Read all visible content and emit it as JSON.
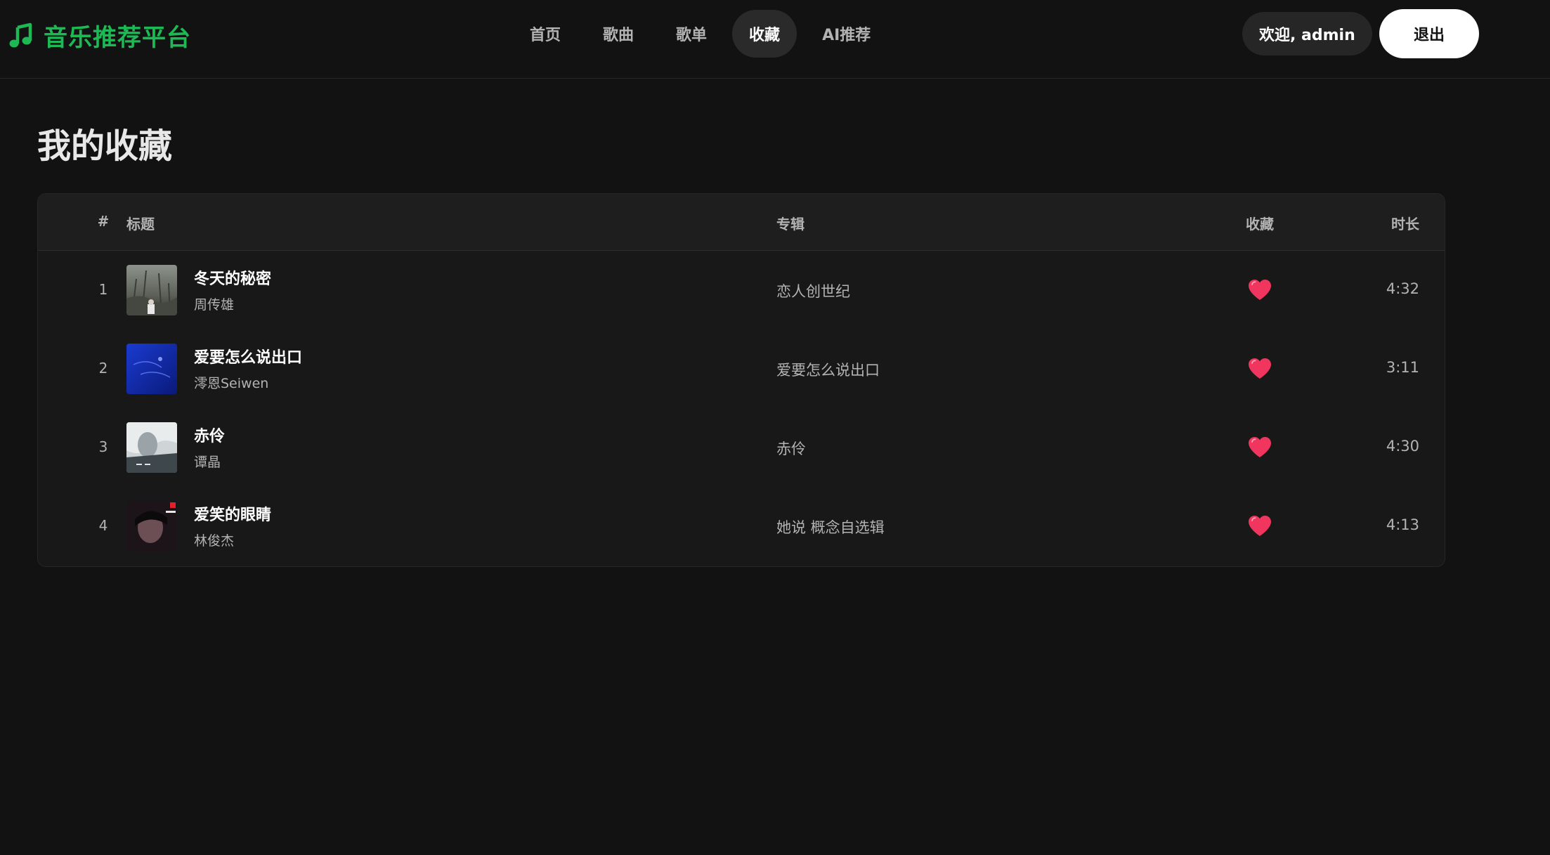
{
  "header": {
    "brand": "音乐推荐平台",
    "nav": [
      {
        "label": "首页"
      },
      {
        "label": "歌曲"
      },
      {
        "label": "歌单"
      },
      {
        "label": "收藏"
      },
      {
        "label": "AI推荐"
      }
    ],
    "active_nav": "收藏",
    "welcome": "欢迎, admin",
    "logout": "退出"
  },
  "main": {
    "title": "我的收藏",
    "table": {
      "columns": {
        "num": "#",
        "title": "标题",
        "album": "专辑",
        "favorite": "收藏",
        "duration": "时长"
      },
      "rows": [
        {
          "num": "1",
          "title": "冬天的秘密",
          "artist": "周传雄",
          "album": "恋人创世纪",
          "duration": "4:32",
          "favorited": true
        },
        {
          "num": "2",
          "title": "爱要怎么说出口",
          "artist": "澪恩Seiwen",
          "album": "爱要怎么说出口",
          "duration": "3:11",
          "favorited": true
        },
        {
          "num": "3",
          "title": "赤伶",
          "artist": "谭晶",
          "album": "赤伶",
          "duration": "4:30",
          "favorited": true
        },
        {
          "num": "4",
          "title": "爱笑的眼睛",
          "artist": "林俊杰",
          "album": "她说 概念自选辑",
          "duration": "4:13",
          "favorited": true
        }
      ]
    }
  },
  "colors": {
    "brand": "#1db954",
    "background": "#121212",
    "heart": "#f0355f"
  },
  "icons": {
    "brand": "music-note-icon",
    "favorite": "heart-icon"
  }
}
